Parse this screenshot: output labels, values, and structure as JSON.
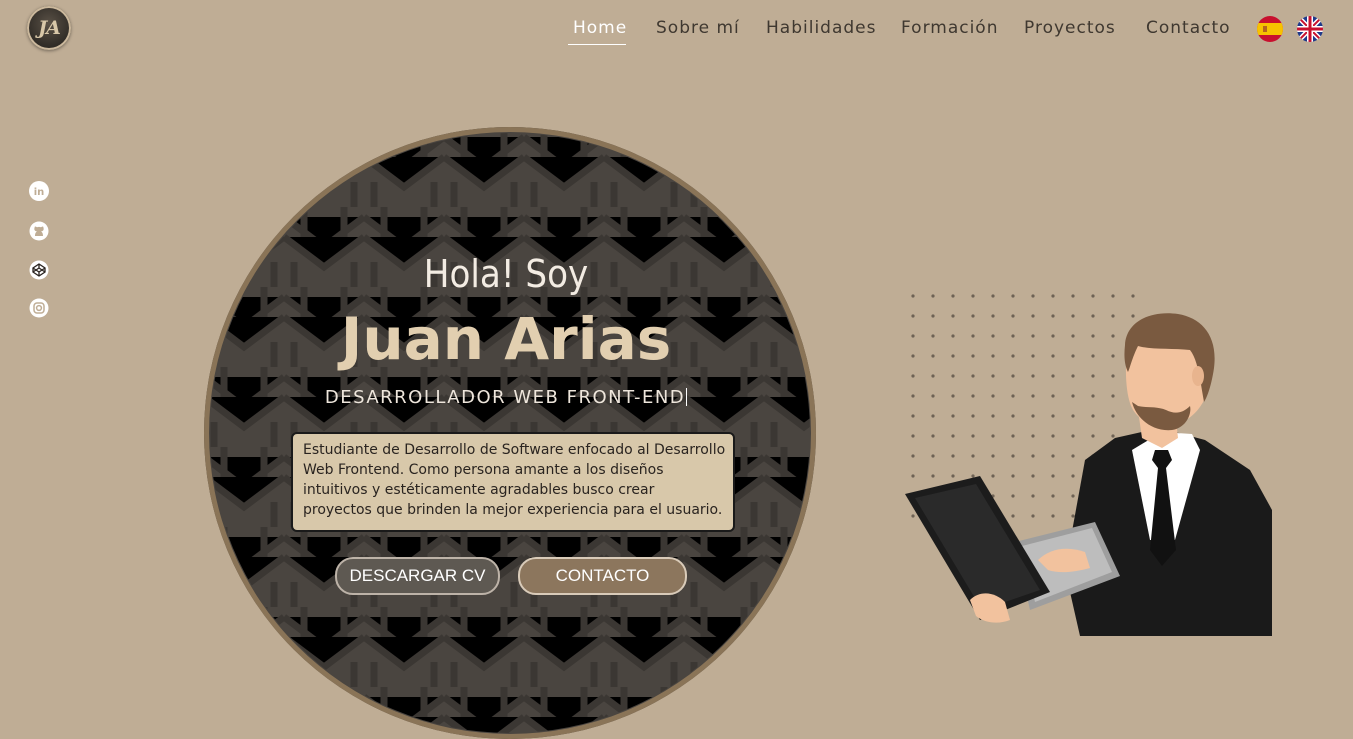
{
  "logo": {
    "text": "JA"
  },
  "nav": {
    "items": [
      {
        "label": "Home",
        "active": true
      },
      {
        "label": "Sobre mí",
        "active": false
      },
      {
        "label": "Habilidades",
        "active": false
      },
      {
        "label": "Formación",
        "active": false
      },
      {
        "label": "Proyectos",
        "active": false
      },
      {
        "label": "Contacto",
        "active": false
      }
    ],
    "languages": [
      "es-flag-icon",
      "uk-flag-icon"
    ]
  },
  "social": [
    "linkedin-icon",
    "github-icon",
    "codepen-icon",
    "instagram-icon"
  ],
  "hero": {
    "greeting": "Hola! Soy",
    "name": "Juan Arias",
    "role": "DESARROLLADOR WEB FRONT-END",
    "description": "Estudiante de Desarrollo de Software enfocado al Desarrollo Web Frontend. Como persona amante a los diseños intuitivos y estéticamente agradables busco crear proyectos que brinden la mejor experiencia para el usuario.",
    "cv_button": "DESCARGAR CV",
    "contact_button": "CONTACTO"
  },
  "colors": {
    "background": "#bfad95",
    "circle": "#4a4540",
    "circle_border": "#8a7457",
    "name_accent": "#e2cfb0",
    "nav_active": "#ffffff",
    "nav_text": "#3f3830"
  }
}
